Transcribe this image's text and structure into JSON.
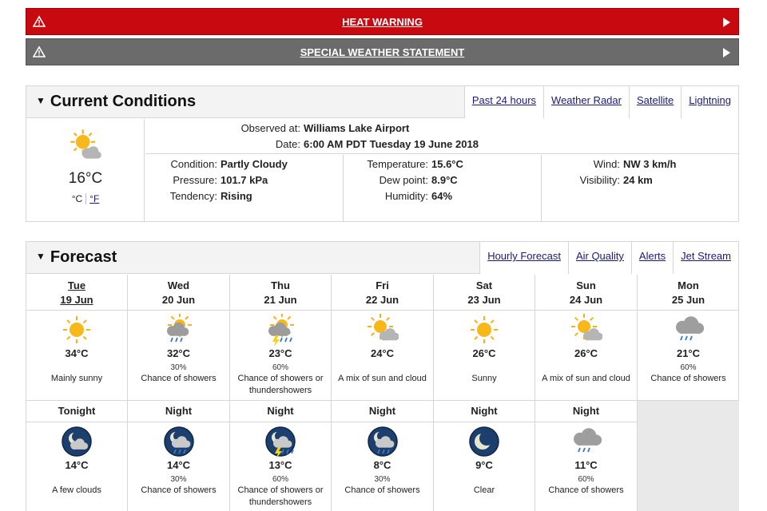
{
  "alerts": [
    {
      "label": "HEAT WARNING",
      "color": "#c8090f",
      "icon": "warning-triangle-icon"
    },
    {
      "label": "SPECIAL WEATHER STATEMENT",
      "color": "#6b6b6b",
      "icon": "warning-triangle-icon"
    }
  ],
  "current": {
    "title": "Current Conditions",
    "links": [
      "Past 24 hours",
      "Weather Radar",
      "Satellite",
      "Lightning"
    ],
    "icon": "partly-cloudy-icon",
    "temp": "16°C",
    "unit_c": "°C",
    "unit_f": "°F",
    "observed_label": "Observed at:",
    "observed_value": "Williams Lake Airport",
    "date_label": "Date:",
    "date_value": "6:00 AM PDT Tuesday 19 June 2018",
    "condition_label": "Condition:",
    "condition_value": "Partly Cloudy",
    "pressure_label": "Pressure:",
    "pressure_value": "101.7 kPa",
    "tendency_label": "Tendency:",
    "tendency_value": "Rising",
    "temperature_label": "Temperature:",
    "temperature_value": "15.6°C",
    "dewpoint_label": "Dew point:",
    "dewpoint_value": "8.9°C",
    "humidity_label": "Humidity:",
    "humidity_value": "64%",
    "wind_label": "Wind:",
    "wind_value": "NW 3 km/h",
    "visibility_label": "Visibility:",
    "visibility_value": "24 km"
  },
  "forecast": {
    "title": "Forecast",
    "links": [
      "Hourly Forecast",
      "Air Quality",
      "Alerts",
      "Jet Stream"
    ],
    "days": [
      {
        "day": "Tue",
        "date": "19 Jun",
        "icon": "sunny-icon",
        "high": "34°C",
        "pop": "",
        "summary": "Mainly sunny"
      },
      {
        "day": "Wed",
        "date": "20 Jun",
        "icon": "sun-cloud-showers-icon",
        "high": "32°C",
        "pop": "30%",
        "summary": "Chance of showers"
      },
      {
        "day": "Thu",
        "date": "21 Jun",
        "icon": "sun-cloud-thunder-icon",
        "high": "23°C",
        "pop": "60%",
        "summary": "Chance of showers or thundershowers"
      },
      {
        "day": "Fri",
        "date": "22 Jun",
        "icon": "partly-cloudy-icon",
        "high": "24°C",
        "pop": "",
        "summary": "A mix of sun and cloud"
      },
      {
        "day": "Sat",
        "date": "23 Jun",
        "icon": "sunny-icon",
        "high": "26°C",
        "pop": "",
        "summary": "Sunny"
      },
      {
        "day": "Sun",
        "date": "24 Jun",
        "icon": "partly-cloudy-icon",
        "high": "26°C",
        "pop": "",
        "summary": "A mix of sun and cloud"
      },
      {
        "day": "Mon",
        "date": "25 Jun",
        "icon": "cloud-showers-icon",
        "high": "21°C",
        "pop": "60%",
        "summary": "Chance of showers"
      }
    ],
    "nights": [
      {
        "label": "Tonight",
        "icon": "moon-cloud-icon",
        "low": "14°C",
        "pop": "",
        "summary": "A few clouds"
      },
      {
        "label": "Night",
        "icon": "moon-cloud-showers-icon",
        "low": "14°C",
        "pop": "30%",
        "summary": "Chance of showers"
      },
      {
        "label": "Night",
        "icon": "moon-cloud-thunder-icon",
        "low": "13°C",
        "pop": "60%",
        "summary": "Chance of showers or thundershowers"
      },
      {
        "label": "Night",
        "icon": "moon-cloud-showers-icon",
        "low": "8°C",
        "pop": "30%",
        "summary": "Chance of showers"
      },
      {
        "label": "Night",
        "icon": "clear-night-icon",
        "low": "9°C",
        "pop": "",
        "summary": "Clear"
      },
      {
        "label": "Night",
        "icon": "cloud-showers-icon",
        "low": "11°C",
        "pop": "60%",
        "summary": "Chance of showers"
      }
    ]
  }
}
